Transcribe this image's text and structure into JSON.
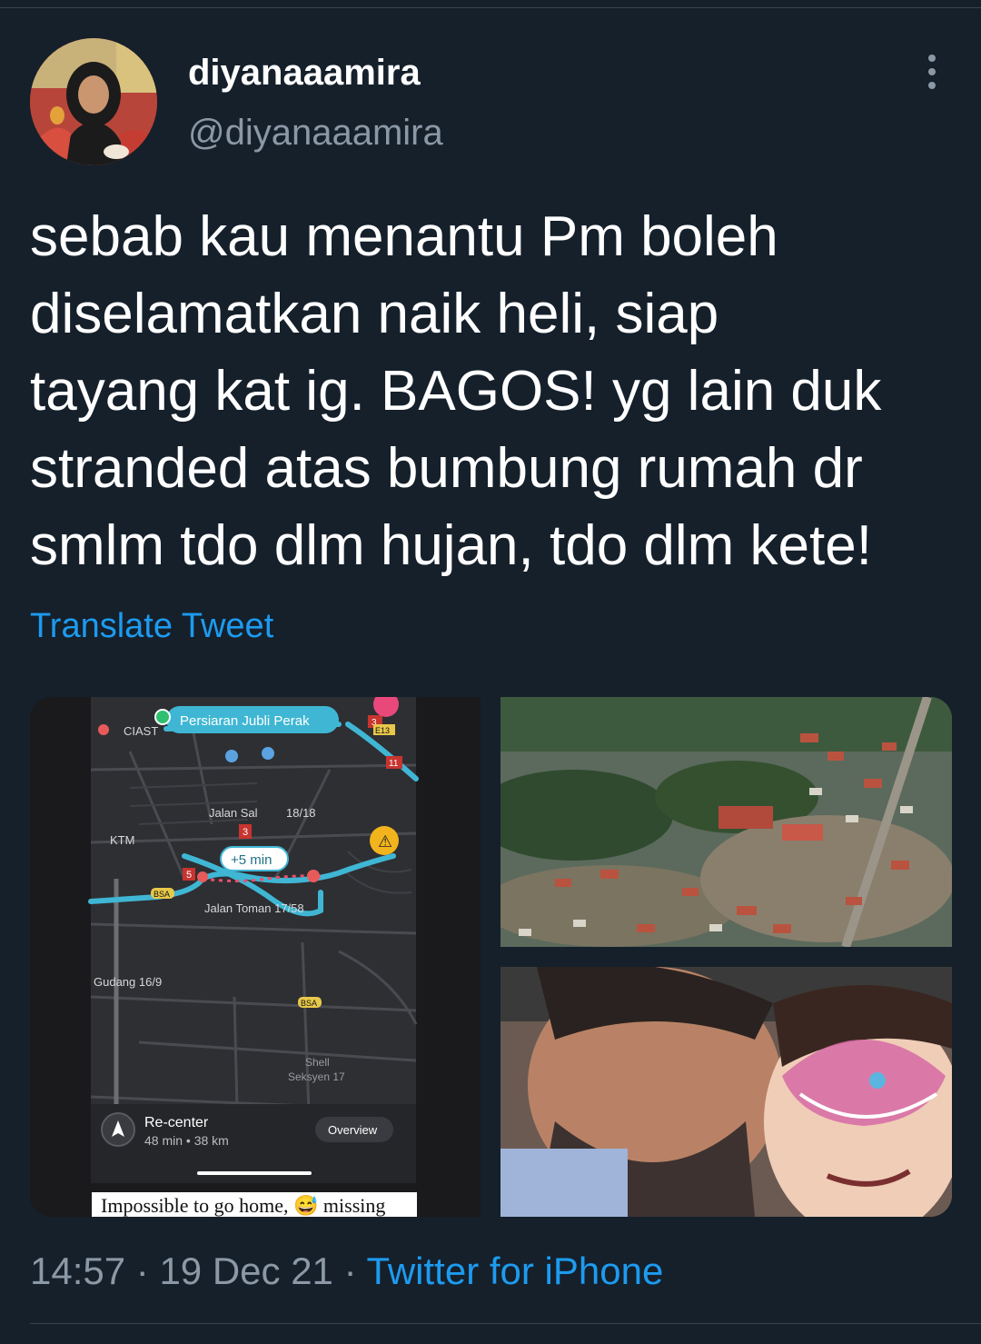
{
  "tweet": {
    "display_name": "diyanaaamira",
    "handle": "@diyanaaamira",
    "text": "sebab kau menantu Pm boleh\ndiselamatkan naik heli, siap\ntayang kat ig. BAGOS! yg lain duk\nstranded atas bumbung rumah dr\nsmlm tdo dlm hujan, tdo dlm kete!",
    "translate_label": "Translate Tweet",
    "time": "14:57",
    "separator": "·",
    "date": "19 Dec 21",
    "source": "Twitter for iPhone"
  },
  "media": {
    "map": {
      "destination_label": "Persiaran Jubli Perak",
      "labels": [
        "CIAST",
        "Jalan Sal",
        "18/18",
        "KTM",
        "+5 min",
        "Jalan Toman 17/58",
        "Gudang 16/9",
        "Shell",
        "Seksyen 17"
      ],
      "badges": [
        "3",
        "E13",
        "11",
        "3",
        "5",
        "BSA",
        "BSA"
      ],
      "recenter_label": "Re-center",
      "trip_info": "48 min • 38 km",
      "overview_label": "Overview",
      "caption": "Impossible to go home, 😅 missing"
    }
  },
  "icons": {
    "more": "more-vertical-icon",
    "warning": "warning-icon",
    "recenter": "navigation-arrow-icon"
  },
  "colors": {
    "background": "#15202b",
    "link": "#1d9bf0",
    "secondary_text": "#8b98a5",
    "route": "#3fb7d4"
  }
}
